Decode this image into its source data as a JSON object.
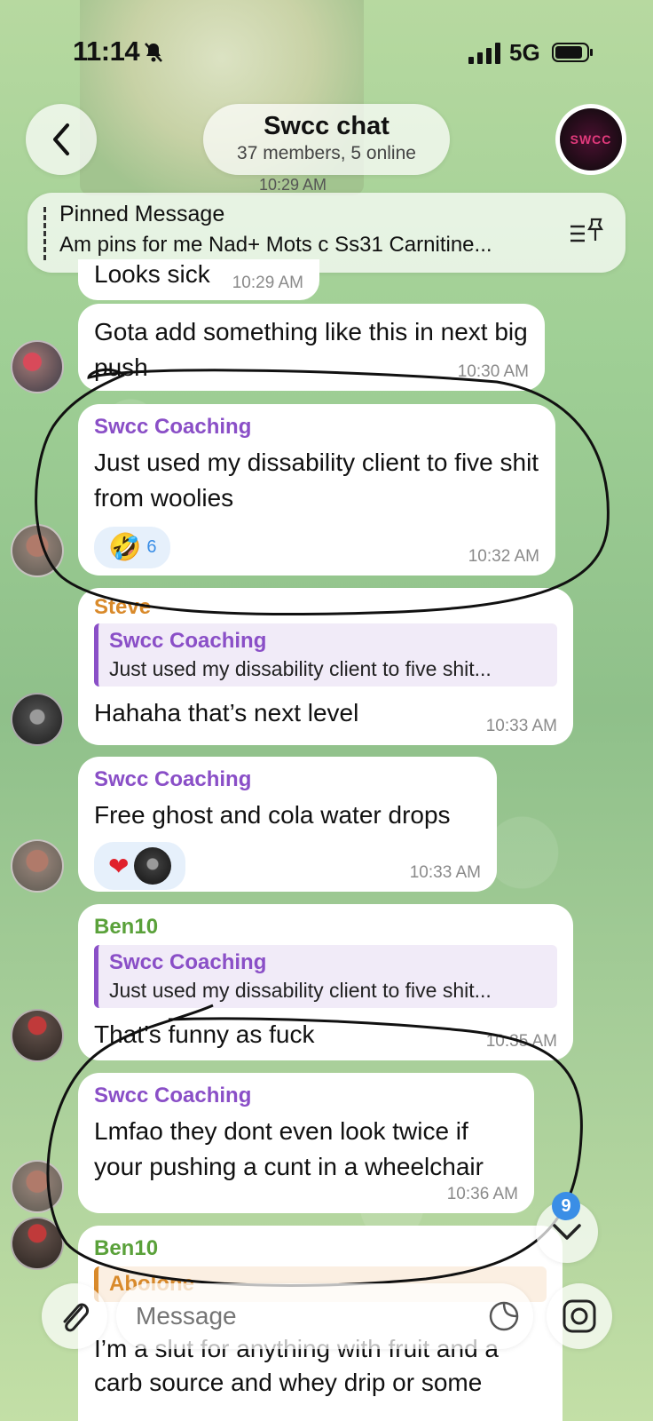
{
  "status": {
    "time": "11:14",
    "network": "5G"
  },
  "header": {
    "title": "Swcc chat",
    "subtitle": "37 members, 5 online",
    "date_chip": "10:29 AM",
    "group_avatar_text": "SWCC"
  },
  "pinned": {
    "title": "Pinned Message",
    "text": "Am pins for me Nad+ Mots c Ss31 Carnitine..."
  },
  "messages": [
    {
      "text": "Looks sick",
      "time": "10:29 AM"
    },
    {
      "text": "Gota add something like this in next big push",
      "time": "10:30 AM"
    },
    {
      "sender": "Swcc Coaching",
      "text": "Just used my dissability client to five shit from woolies",
      "reaction_count": "6",
      "time": "10:32 AM"
    },
    {
      "sender": "Steve",
      "reply_name": "Swcc Coaching",
      "reply_text": "Just used my dissability client to five shit...",
      "text": "Hahaha that’s next level",
      "time": "10:33 AM"
    },
    {
      "sender": "Swcc Coaching",
      "text": "Free ghost and cola water drops",
      "time": "10:33 AM"
    },
    {
      "sender": "Ben10",
      "reply_name": "Swcc Coaching",
      "reply_text": "Just used my dissability client to five shit...",
      "text": "That’s funny as fuck",
      "time": "10:35 AM"
    },
    {
      "sender": "Swcc Coaching",
      "text": "Lmfao they dont even look twice if your pushing a cunt in a wheelchair",
      "time": "10:36 AM"
    },
    {
      "sender": "Ben10",
      "reply_name": "Abolone",
      "text": "I’m a slut for anything with fruit and a carb source and whey drip or some"
    }
  ],
  "scroll": {
    "unread_count": "9"
  },
  "composer": {
    "placeholder": "Message"
  },
  "colors": {
    "swcc_sender": "#8a4fc7",
    "steve_sender": "#d98a2b",
    "ben_sender": "#5aa13a",
    "badge": "#3a8ee6"
  }
}
